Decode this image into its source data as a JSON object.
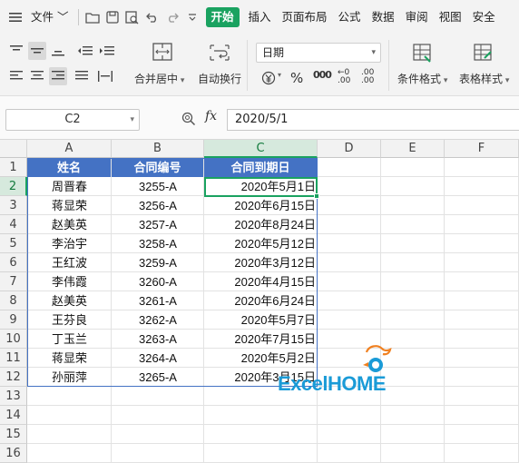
{
  "menubar": {
    "file_label": "文件",
    "tabs": [
      "开始",
      "插入",
      "页面布局",
      "公式",
      "数据",
      "审阅",
      "视图",
      "安全"
    ],
    "active_tab": "开始"
  },
  "ribbon": {
    "merge_label": "合并居中",
    "wrap_label": "自动换行",
    "number_format": "日期",
    "percent": "%",
    "thousands": "000",
    "inc_decimal": ".00",
    "dec_decimal": ".00",
    "conditional_label": "条件格式",
    "table_style_label": "表格样式"
  },
  "formula_bar": {
    "name_box": "C2",
    "fx_label": "fx",
    "value": "2020/5/1"
  },
  "sheet": {
    "columns": [
      "A",
      "B",
      "C",
      "D",
      "E",
      "F"
    ],
    "rows": [
      "1",
      "2",
      "3",
      "4",
      "5",
      "6",
      "7",
      "8",
      "9",
      "10",
      "11",
      "12",
      "13",
      "14",
      "15",
      "16"
    ],
    "selected_column": "C",
    "selected_row": "2",
    "header": [
      "姓名",
      "合同编号",
      "合同到期日"
    ],
    "data": [
      [
        "周晋春",
        "3255-A",
        "2020年5月1日"
      ],
      [
        "蒋显荣",
        "3256-A",
        "2020年6月15日"
      ],
      [
        "赵美英",
        "3257-A",
        "2020年8月24日"
      ],
      [
        "李治宇",
        "3258-A",
        "2020年5月12日"
      ],
      [
        "王红波",
        "3259-A",
        "2020年3月12日"
      ],
      [
        "李伟霞",
        "3260-A",
        "2020年4月15日"
      ],
      [
        "赵美英",
        "3261-A",
        "2020年6月24日"
      ],
      [
        "王芬良",
        "3262-A",
        "2020年5月7日"
      ],
      [
        "丁玉兰",
        "3263-A",
        "2020年7月15日"
      ],
      [
        "蒋显荣",
        "3264-A",
        "2020年5月2日"
      ],
      [
        "孙丽萍",
        "3265-A",
        "2020年3月15日"
      ]
    ]
  },
  "watermark": {
    "text_a": "Excel",
    "text_b": "HOME"
  },
  "colors": {
    "accent": "#1aa260",
    "table_header": "#4472c4"
  }
}
